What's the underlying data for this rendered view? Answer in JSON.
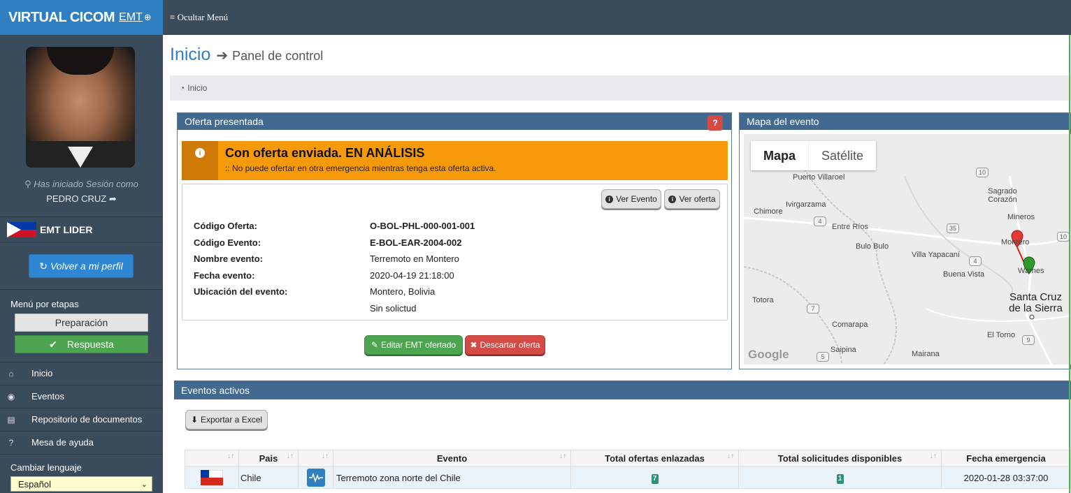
{
  "app": {
    "brand": "VIRTUAL CICOM",
    "brand_sub": "EMT"
  },
  "topbar": {
    "toggle_label": "≡ Ocultar Menú"
  },
  "sidebar": {
    "session_label": "Has iniciado Sesión como",
    "user_name": "PEDRO CRUZ",
    "role": "EMT LIDER",
    "profile_button": "Volver a mi perfil",
    "stages_title": "Menú por etapas",
    "stages": [
      {
        "label": "Preparación"
      },
      {
        "label": "Respuesta"
      }
    ],
    "nav": [
      {
        "label": "Inicio"
      },
      {
        "label": "Eventos"
      },
      {
        "label": "Repositorio de documentos"
      },
      {
        "label": "Mesa de ayuda"
      }
    ],
    "language_title": "Cambiar lenguaje",
    "language_value": "Español"
  },
  "page": {
    "title": "Inicio",
    "subtitle": "Panel de control",
    "breadcrumb": "Inicio"
  },
  "offer": {
    "header": "Oferta presentada",
    "alert_title": "Con oferta enviada. EN ANÁLISIS",
    "alert_text": ":: No puede ofertar en otra emergencia mientras tenga esta oferta activa.",
    "btn_view_event": "Ver Evento",
    "btn_view_offer": "Ver oferta",
    "rows": [
      {
        "label": "Código Oferta:",
        "value": "O-BOL-PHL-000-001-001"
      },
      {
        "label": "Código Evento:",
        "value": "E-BOL-EAR-2004-002"
      },
      {
        "label": "Nombre evento:",
        "value": "Terremoto en Montero"
      },
      {
        "label": "Fecha evento:",
        "value": "2020-04-19 21:18:00"
      },
      {
        "label": "Ubicación del evento:",
        "value": "Montero, Bolivia"
      }
    ],
    "extra_value": "Sin solictud",
    "btn_edit": "Editar EMT ofertado",
    "btn_discard": "Descartar oferta"
  },
  "map": {
    "header": "Mapa del evento",
    "tab_map": "Mapa",
    "tab_sat": "Satélite",
    "labels": [
      "Puerto Villaroel",
      "Ivirgarzama",
      "Chimore",
      "Entre Ríos",
      "Bulo Bulo",
      "Villa Yapacaní",
      "Buena Vista",
      "Sagrado Corazón",
      "Mineros",
      "Montero",
      "Warnes",
      "Santa Cruz de la Sierra",
      "Totora",
      "Comarapa",
      "Saipina",
      "Mairana",
      "El Torno"
    ],
    "google_label": "Google"
  },
  "events": {
    "header": "Eventos activos",
    "export_button": "Exportar a Excel",
    "columns": [
      "",
      "Pais",
      "",
      "Evento",
      "Total ofertas enlazadas",
      "Total solicitudes disponibles",
      "Fecha emergencia"
    ],
    "rows": [
      {
        "country": "Chile",
        "event": "Terremoto zona norte del Chile",
        "offers": "7",
        "requests": "1",
        "date": "2020-01-28 03:37:00"
      }
    ]
  },
  "colors": {
    "accent": "#2f7fc1",
    "sidebar": "#3a4b5c",
    "success": "#4ea54f",
    "danger": "#d44a45",
    "warning": "#f79a0a"
  }
}
